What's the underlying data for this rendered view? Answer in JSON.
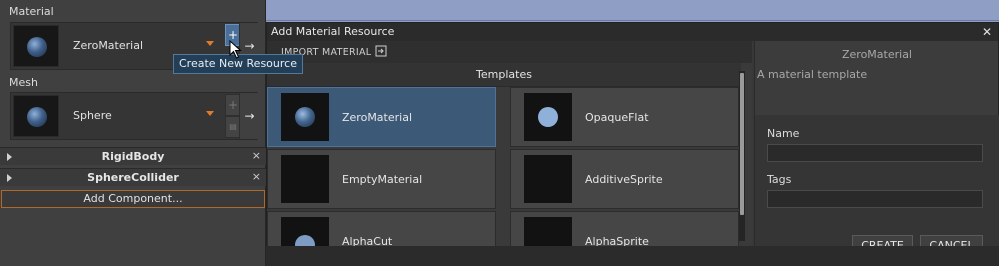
{
  "inspector": {
    "material_section": {
      "title": "Material",
      "resource_name": "ZeroMaterial",
      "add_button": "+",
      "open_button": "→"
    },
    "mesh_section": {
      "title": "Mesh",
      "resource_name": "Sphere",
      "add_button": "+",
      "dup_button": "▤",
      "open_button": "→"
    },
    "components": [
      {
        "name": "RigidBody",
        "close": "×"
      },
      {
        "name": "SphereCollider",
        "close": "×"
      }
    ],
    "add_component_label": "Add Component..."
  },
  "tooltip": "Create New Resource",
  "dialog": {
    "title": "Add Material Resource",
    "close": "✕",
    "import_label": "IMPORT MATERIAL",
    "templates_header": "Templates",
    "templates": [
      {
        "name": "ZeroMaterial",
        "selected": true,
        "preview": "shaded-sphere"
      },
      {
        "name": "OpaqueFlat",
        "selected": false,
        "preview": "flat-sphere"
      },
      {
        "name": "EmptyMaterial",
        "selected": false,
        "preview": "empty"
      },
      {
        "name": "AdditiveSprite",
        "selected": false,
        "preview": "empty"
      },
      {
        "name": "AlphaCut",
        "selected": false,
        "preview": "flat-sphere"
      },
      {
        "name": "AlphaSprite",
        "selected": false,
        "preview": "empty"
      }
    ],
    "details": {
      "title": "ZeroMaterial",
      "description": "A material template",
      "name_label": "Name",
      "name_value": "",
      "tags_label": "Tags",
      "tags_value": "",
      "create_label": "CREATE",
      "cancel_label": "CANCEL"
    }
  },
  "colors": {
    "selected_tile": "#3c5a78",
    "accent_orange": "#e07b2b",
    "tooltip_bg": "#233f57",
    "scene_sky": "#8f9ec4"
  }
}
